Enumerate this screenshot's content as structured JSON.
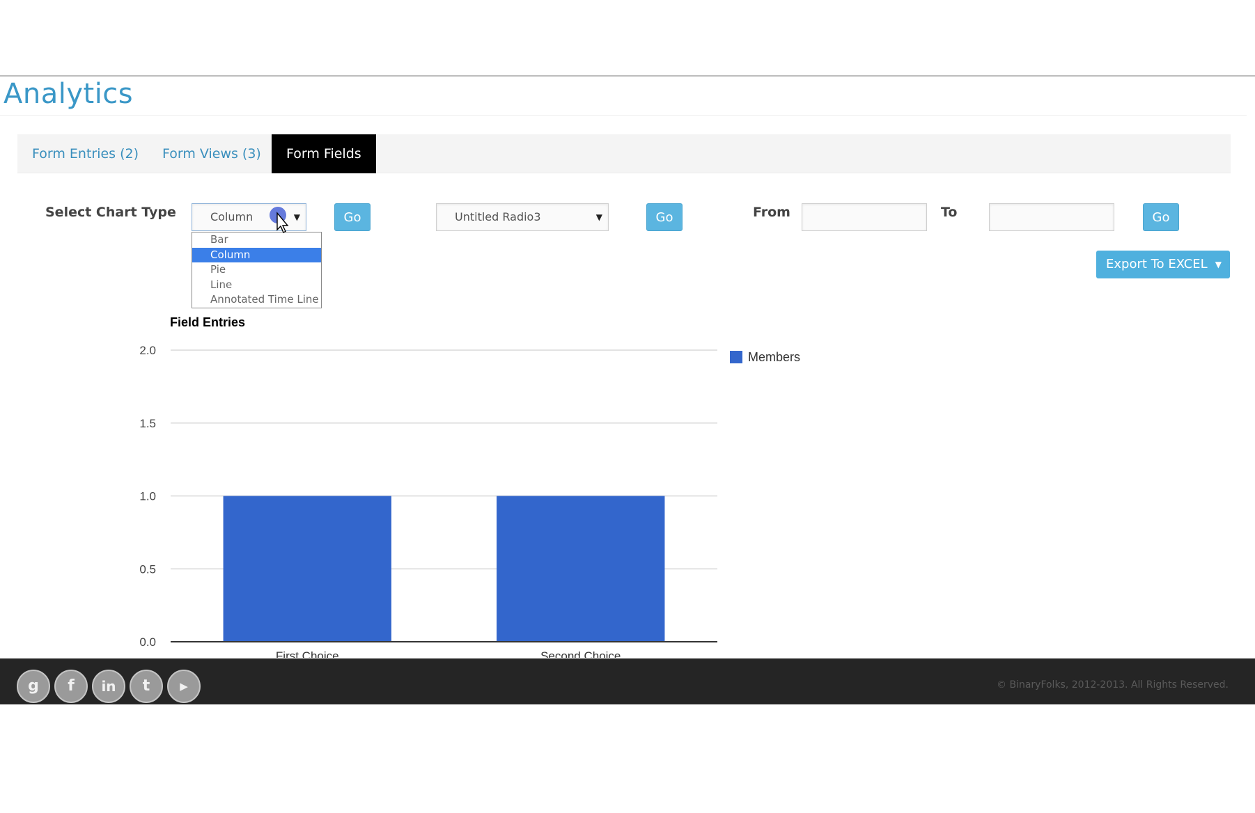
{
  "page": {
    "title": "Analytics",
    "accent_color": "#3a97c7"
  },
  "tabs": [
    {
      "label": "Form Entries (2)",
      "active": false
    },
    {
      "label": "Form Views (3)",
      "active": false
    },
    {
      "label": "Form Fields",
      "active": true
    }
  ],
  "controls": {
    "chart_type_label": "Select Chart Type",
    "chart_type_value": "Column",
    "chart_type_options": [
      "Bar",
      "Column",
      "Pie",
      "Line",
      "Annotated Time Line"
    ],
    "go_label": "Go",
    "field_select_value": "Untitled Radio3",
    "from_label": "From",
    "from_value": "",
    "to_label": "To",
    "to_value": "",
    "export_label": "Export To EXCEL",
    "button_color": "#5bb5e0"
  },
  "chart_data": {
    "type": "bar",
    "title": "Field Entries",
    "categories": [
      "First Choice",
      "Second Choice"
    ],
    "series": [
      {
        "name": "Members",
        "values": [
          1.0,
          1.0
        ],
        "color": "#3366cc"
      }
    ],
    "ylim": [
      0,
      2
    ],
    "yticks": [
      "2.0",
      "1.5",
      "1.0",
      "0.5",
      "0.0"
    ],
    "grid": true,
    "legend_position": "right"
  },
  "footer": {
    "social_icons": [
      "google-plus-icon",
      "facebook-icon",
      "linkedin-icon",
      "twitter-icon",
      "youtube-icon"
    ],
    "copyright": "© BinaryFolks, 2012-2013. All Rights Reserved."
  }
}
